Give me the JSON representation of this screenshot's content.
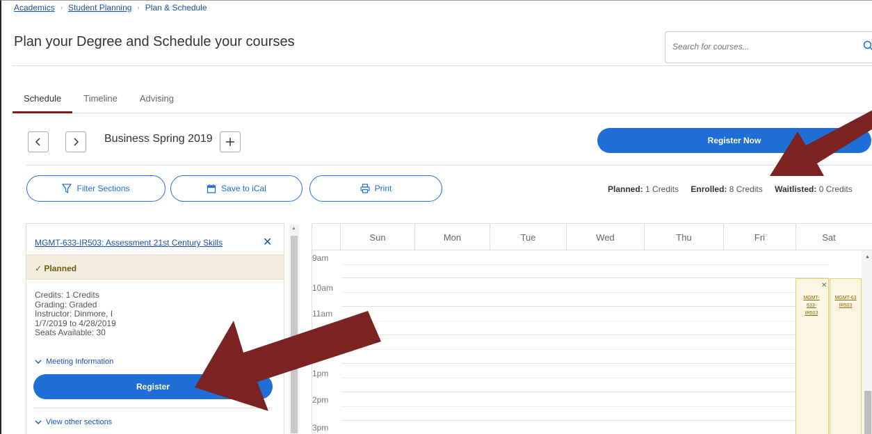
{
  "breadcrumb": {
    "items": [
      "Academics",
      "Student Planning",
      "Plan & Schedule"
    ]
  },
  "header": {
    "title": "Plan your Degree and Schedule your courses",
    "search_placeholder": "Search for courses..."
  },
  "tabs": [
    {
      "label": "Schedule",
      "active": true
    },
    {
      "label": "Timeline",
      "active": false
    },
    {
      "label": "Advising",
      "active": false
    }
  ],
  "term": {
    "name": "Business Spring 2019"
  },
  "actions": {
    "register_now": "Register Now",
    "filter_sections": "Filter Sections",
    "save_ical": "Save to iCal",
    "print": "Print"
  },
  "credits": {
    "planned_label": "Planned:",
    "planned_value": "1 Credits",
    "enrolled_label": "Enrolled:",
    "enrolled_value": "8 Credits",
    "waitlisted_label": "Waitlisted:",
    "waitlisted_value": "0 Credits"
  },
  "course_card": {
    "title": "MGMT-633-IR503: Assessment 21st Century Skills",
    "status": "Planned",
    "details": [
      "Credits: 1 Credits",
      "Grading: Graded",
      "Instructor: Dinmore, I",
      "1/7/2019 to 4/28/2019",
      "Seats Available: 30"
    ],
    "meeting_info": "Meeting Information",
    "register": "Register",
    "view_other": "View other sections"
  },
  "calendar": {
    "days": [
      "Sun",
      "Mon",
      "Tue",
      "Wed",
      "Thu",
      "Fri",
      "Sat"
    ],
    "hours": [
      "9am",
      "10am",
      "11am",
      "1pm",
      "2pm",
      "3pm"
    ],
    "events": [
      {
        "label_line1": "MGMT-633-",
        "label_line2": "IR503"
      },
      {
        "label_line1": "MGMT-63",
        "label_line2": "IR503"
      }
    ]
  },
  "colors": {
    "primary": "#1f6fd6",
    "link": "#1a55a6",
    "tab_active": "#7b2020",
    "planned_bg": "#f5eedf",
    "annotation_arrow": "#7b2323"
  }
}
